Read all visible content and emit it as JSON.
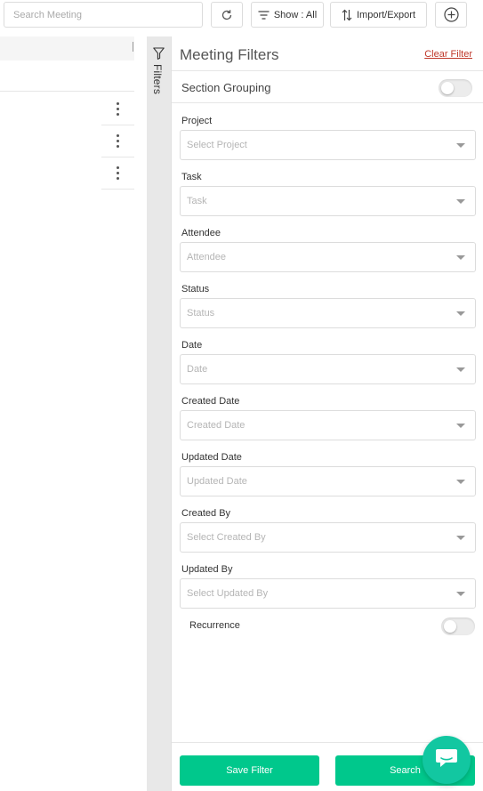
{
  "toolbar": {
    "search_placeholder": "Search Meeting",
    "refresh_icon": "refresh-icon",
    "show_label": "Show : All",
    "filter_lines_icon": "filter-lines-icon",
    "import_export_label": "Import/Export",
    "import_export_icon": "sort-arrows-icon",
    "add_icon": "plus-circle-icon"
  },
  "filters_tab": {
    "label": "Filters",
    "icon": "funnel-icon"
  },
  "panel": {
    "title": "Meeting Filters",
    "clear_label": "Clear Filter",
    "section_grouping_label": "Section Grouping",
    "section_grouping_on": false,
    "fields": [
      {
        "label": "Project",
        "placeholder": "Select Project"
      },
      {
        "label": "Task",
        "placeholder": "Task"
      },
      {
        "label": "Attendee",
        "placeholder": "Attendee"
      },
      {
        "label": "Status",
        "placeholder": "Status"
      },
      {
        "label": "Date",
        "placeholder": "Date"
      },
      {
        "label": "Created Date",
        "placeholder": "Created Date"
      },
      {
        "label": "Updated Date",
        "placeholder": "Updated Date"
      },
      {
        "label": "Created By",
        "placeholder": "Select Created By"
      },
      {
        "label": "Updated By",
        "placeholder": "Select Updated By"
      }
    ],
    "recurrence_label": "Recurrence",
    "recurrence_on": false,
    "save_filter_label": "Save Filter",
    "search_label": "Search"
  },
  "chat": {
    "icon": "chat-bubble-icon"
  },
  "colors": {
    "accent_green": "#00c88c",
    "chat_teal": "#12c7a1",
    "clear_link": "#c0392b"
  }
}
